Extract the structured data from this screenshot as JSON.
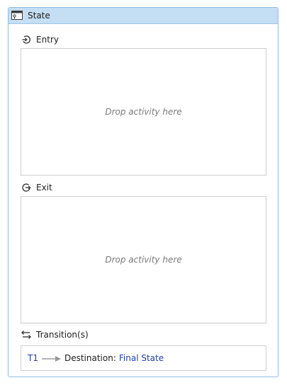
{
  "state": {
    "title": "State",
    "title_icon": "state-icon"
  },
  "entry": {
    "label": "Entry",
    "icon": "entry-icon",
    "placeholder": "Drop activity here"
  },
  "exit": {
    "label": "Exit",
    "icon": "exit-icon",
    "placeholder": "Drop activity here"
  },
  "transitions": {
    "label": "Transition(s)",
    "icon": "transitions-icon",
    "items": [
      {
        "name": "T1",
        "destination_label": "Destination:",
        "destination_value": "Final State"
      }
    ]
  },
  "colors": {
    "header_bg": "#c4def3",
    "border": "#8fbfe0",
    "link": "#1f3fb8",
    "placeholder_text": "#7a7a7a"
  }
}
